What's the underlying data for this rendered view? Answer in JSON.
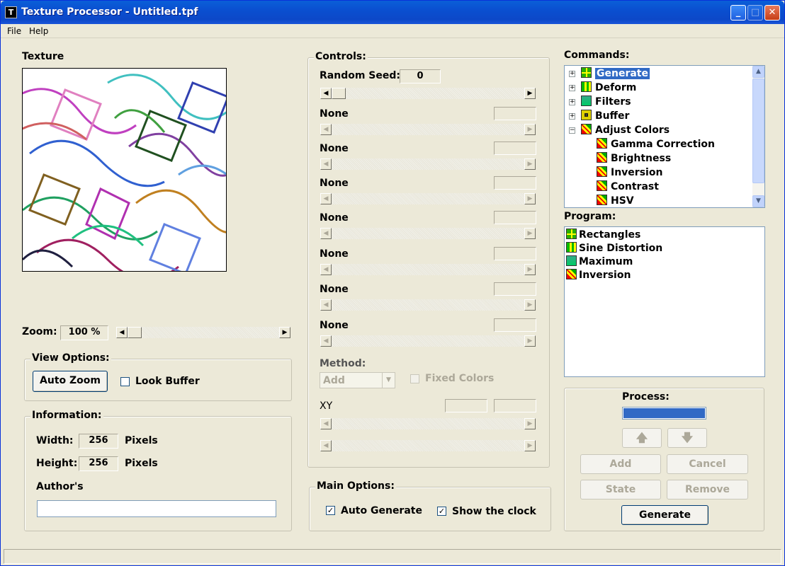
{
  "window": {
    "title": "Texture Processor - Untitled.tpf",
    "app_icon": "T"
  },
  "menu": [
    "File",
    "Help"
  ],
  "texture": {
    "label": "Texture",
    "zoom_label": "Zoom:",
    "zoom_value": "100 %"
  },
  "view_options": {
    "caption": "View Options:",
    "auto_zoom": "Auto Zoom",
    "look_buffer": "Look Buffer",
    "look_buffer_checked": false
  },
  "information": {
    "caption": "Information:",
    "width_label": "Width:",
    "width_value": "256",
    "height_label": "Height:",
    "height_value": "256",
    "unit": "Pixels",
    "author_label": "Author's",
    "author_value": ""
  },
  "controls": {
    "caption": "Controls:",
    "random_seed_label": "Random Seed:",
    "random_seed_value": "0",
    "params": [
      "None",
      "None",
      "None",
      "None",
      "None",
      "None",
      "None"
    ],
    "method_label": "Method:",
    "method_value": "Add",
    "fixed_colors": "Fixed Colors",
    "fixed_colors_checked": false,
    "xy_label": "XY"
  },
  "main_options": {
    "caption": "Main Options:",
    "auto_generate": "Auto Generate",
    "auto_generate_checked": true,
    "show_clock": "Show the clock",
    "show_clock_checked": true
  },
  "commands": {
    "label": "Commands:",
    "tree": [
      {
        "label": "Generate",
        "icon": "generate-icon",
        "expand": "+",
        "selected": true
      },
      {
        "label": "Deform",
        "icon": "deform-icon",
        "expand": "+"
      },
      {
        "label": "Filters",
        "icon": "filters-icon",
        "expand": "+"
      },
      {
        "label": "Buffer",
        "icon": "buffer-icon",
        "expand": "+"
      },
      {
        "label": "Adjust Colors",
        "icon": "adjust-colors-icon",
        "expand": "−"
      }
    ],
    "children": [
      "Gamma Correction",
      "Brightness",
      "Inversion",
      "Contrast",
      "HSV"
    ]
  },
  "program": {
    "label": "Program:",
    "items": [
      {
        "label": "Rectangles",
        "icon": "generate-icon"
      },
      {
        "label": "Sine Distortion",
        "icon": "deform-icon"
      },
      {
        "label": "Maximum",
        "icon": "filters-icon"
      },
      {
        "label": "Inversion",
        "icon": "adjust-colors-icon"
      }
    ]
  },
  "process": {
    "label": "Process:",
    "progress": 1.0,
    "up_icon": "up-arrow-icon",
    "down_icon": "down-arrow-icon",
    "add": "Add",
    "cancel": "Cancel",
    "state": "State",
    "remove": "Remove",
    "generate": "Generate"
  },
  "colors": {
    "titlebar": "#0a5fd8",
    "selection": "#316ac5",
    "window_bg": "#ece9d8"
  }
}
